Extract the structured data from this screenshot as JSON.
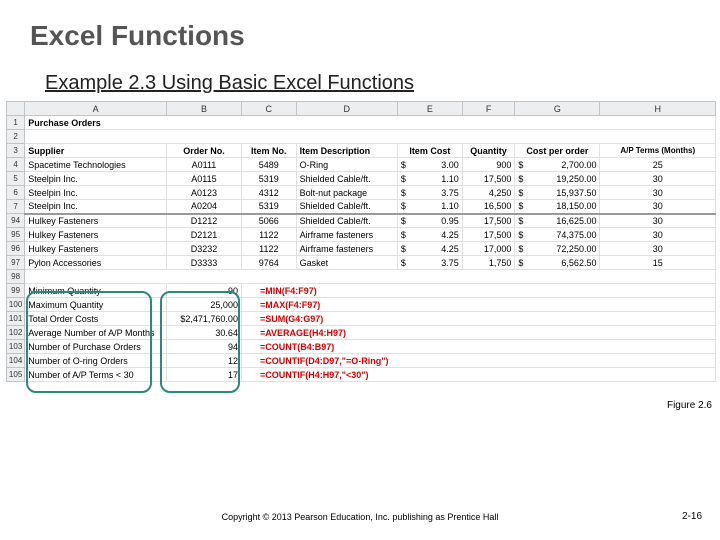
{
  "slide": {
    "title": "Excel Functions",
    "subtitle": "Example 2.3  Using Basic Excel Functions",
    "figure_label": "Figure 2.6",
    "copyright": "Copyright © 2013 Pearson Education, Inc.  publishing as Prentice Hall",
    "pagenum": "2-16"
  },
  "cols": [
    "A",
    "B",
    "C",
    "D",
    "E",
    "F",
    "G",
    "H"
  ],
  "head": {
    "r1": "1",
    "a1": "Purchase Orders",
    "r2": "2",
    "r3": "3",
    "supplier": "Supplier",
    "orderno": "Order No.",
    "itemno": "Item No.",
    "itemdesc": "Item Description",
    "itemcost": "Item Cost",
    "qty": "Quantity",
    "cpo": "Cost per order",
    "apterms": "A/P Terms (Months)"
  },
  "top_rows": [
    {
      "r": "4",
      "s": "Spacetime Technologies",
      "on": "A0111",
      "in": "5489",
      "d": "O-Ring",
      "cost": "3.00",
      "q": "900",
      "cp": "2,700.00",
      "ap": "25"
    },
    {
      "r": "5",
      "s": "Steelpin Inc.",
      "on": "A0115",
      "in": "5319",
      "d": "Shielded Cable/ft.",
      "cost": "1.10",
      "q": "17,500",
      "cp": "19,250.00",
      "ap": "30"
    },
    {
      "r": "6",
      "s": "Steelpin Inc.",
      "on": "A0123",
      "in": "4312",
      "d": "Bolt-nut package",
      "cost": "3.75",
      "q": "4,250",
      "cp": "15,937.50",
      "ap": "30"
    },
    {
      "r": "7",
      "s": "Steelpin Inc.",
      "on": "A0204",
      "in": "5319",
      "d": "Shielded Cable/ft.",
      "cost": "1.10",
      "q": "16,500",
      "cp": "18,150.00",
      "ap": "30"
    }
  ],
  "mid_rows": [
    {
      "r": "94",
      "s": "Hulkey Fasteners",
      "on": "D1212",
      "in": "5066",
      "d": "Shielded Cable/ft.",
      "cost": "0.95",
      "q": "17,500",
      "cp": "16,625.00",
      "ap": "30"
    },
    {
      "r": "95",
      "s": "Hulkey Fasteners",
      "on": "D2121",
      "in": "1122",
      "d": "Airframe fasteners",
      "cost": "4.25",
      "q": "17,500",
      "cp": "74,375.00",
      "ap": "30"
    },
    {
      "r": "96",
      "s": "Hulkey Fasteners",
      "on": "D3232",
      "in": "1122",
      "d": "Airframe fasteners",
      "cost": "4.25",
      "q": "17,000",
      "cp": "72,250.00",
      "ap": "30"
    },
    {
      "r": "97",
      "s": "Pylon Accessories",
      "on": "D3333",
      "in": "9764",
      "d": "Gasket",
      "cost": "3.75",
      "q": "1,750",
      "cp": "6,562.50",
      "ap": "15"
    }
  ],
  "summary": [
    {
      "r": "99",
      "l": "Minimum Quantity",
      "v": "90",
      "f": "=MIN(F4:F97)"
    },
    {
      "r": "100",
      "l": "Maximum Quantity",
      "v": "25,000",
      "f": "=MAX(F4:F97)"
    },
    {
      "r": "101",
      "l": "Total Order Costs",
      "v": "$2,471,760.00",
      "f": "=SUM(G4:G97)"
    },
    {
      "r": "102",
      "l": "Average Number of A/P Months",
      "v": "30.64",
      "f": "=AVERAGE(H4:H97)"
    },
    {
      "r": "103",
      "l": "Number of Purchase Orders",
      "v": "94",
      "f": "=COUNT(B4:B97)"
    },
    {
      "r": "104",
      "l": "Number of O-ring Orders",
      "v": "12",
      "f": "=COUNTIF(D4:D97,\"=O-Ring\")"
    },
    {
      "r": "105",
      "l": "Number of A/P Terms < 30",
      "v": "17",
      "f": "=COUNTIF(H4:H97,\"<30\")"
    }
  ],
  "r98": "98"
}
